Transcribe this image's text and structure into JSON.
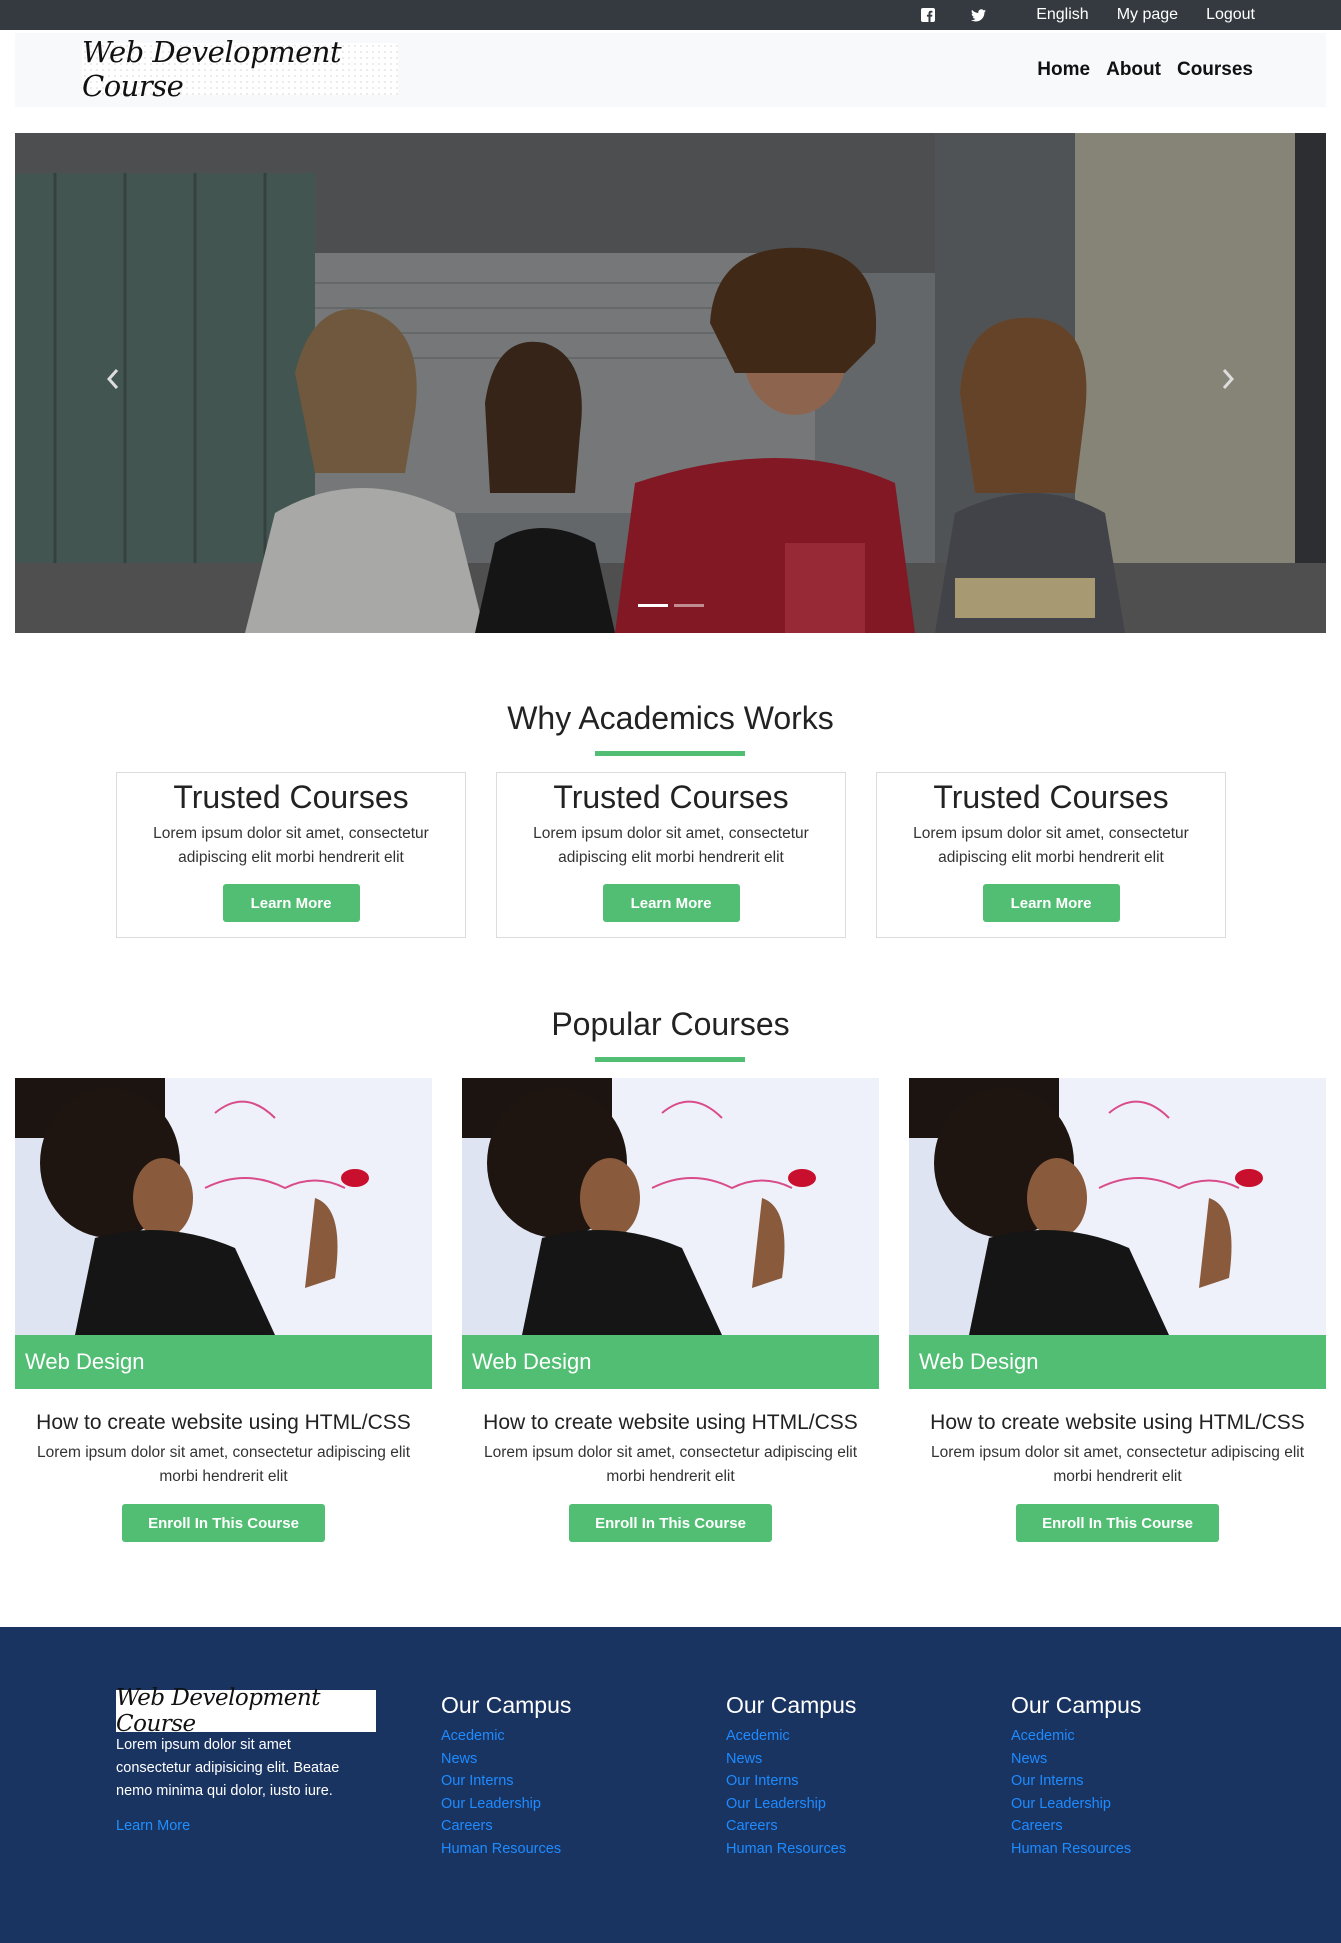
{
  "topbar": {
    "icons": [
      "facebook-icon",
      "twitter-icon"
    ],
    "links": [
      "English",
      "My page",
      "Logout"
    ]
  },
  "navbar": {
    "brand": "Web Development Course",
    "links": [
      "Home",
      "About",
      "Courses"
    ]
  },
  "hero": {
    "indicators_count": 2,
    "active_indicator": 1
  },
  "why": {
    "title": "Why Academics Works",
    "cards": [
      {
        "title": "Trusted Courses",
        "text": "Lorem ipsum dolor sit amet, consectetur adipiscing elit morbi hendrerit elit",
        "button": "Learn More"
      },
      {
        "title": "Trusted Courses",
        "text": "Lorem ipsum dolor sit amet, consectetur adipiscing elit morbi hendrerit elit",
        "button": "Learn More"
      },
      {
        "title": "Trusted Courses",
        "text": "Lorem ipsum dolor sit amet, consectetur adipiscing elit morbi hendrerit elit",
        "button": "Learn More"
      }
    ]
  },
  "popular": {
    "title": "Popular Courses",
    "courses": [
      {
        "tag": "Web Design",
        "title": "How to create website using HTML/CSS",
        "text": "Lorem ipsum dolor sit amet, consectetur adipiscing elit morbi hendrerit elit",
        "button": "Enroll In This Course"
      },
      {
        "tag": "Web Design",
        "title": "How to create website using HTML/CSS",
        "text": "Lorem ipsum dolor sit amet, consectetur adipiscing elit morbi hendrerit elit",
        "button": "Enroll In This Course"
      },
      {
        "tag": "Web Design",
        "title": "How to create website using HTML/CSS",
        "text": "Lorem ipsum dolor sit amet, consectetur adipiscing elit morbi hendrerit elit",
        "button": "Enroll In This Course"
      }
    ]
  },
  "footer": {
    "brand": "Web Development Course",
    "text": "Lorem ipsum dolor sit amet consectetur adipisicing elit. Beatae nemo minima qui dolor, iusto iure.",
    "learn_more": "Learn More",
    "columns": [
      {
        "title": "Our Campus",
        "links": [
          "Acedemic",
          "News",
          "Our Interns",
          "Our Leadership",
          "Careers",
          "Human Resources"
        ]
      },
      {
        "title": "Our Campus",
        "links": [
          "Acedemic",
          "News",
          "Our Interns",
          "Our Leadership",
          "Careers",
          "Human Resources"
        ]
      },
      {
        "title": "Our Campus",
        "links": [
          "Acedemic",
          "News",
          "Our Interns",
          "Our Leadership",
          "Careers",
          "Human Resources"
        ]
      }
    ]
  },
  "colors": {
    "topbar": "#343a40",
    "accent_green": "#52be73",
    "footer_bg": "#1a3462",
    "footer_link": "#1e8bff"
  }
}
